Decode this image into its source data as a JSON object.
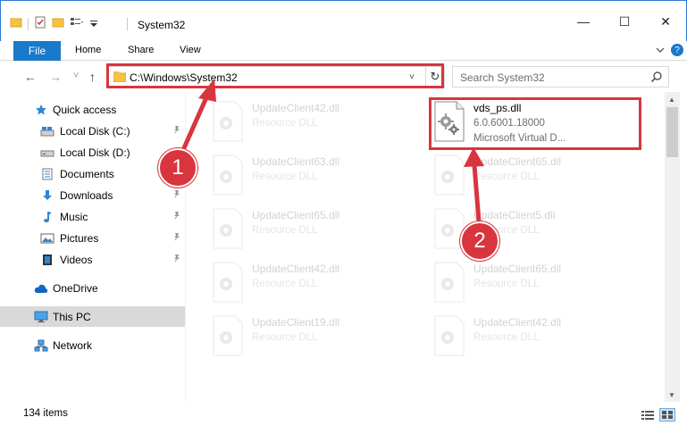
{
  "window": {
    "title": "System32",
    "minimize_glyph": "—",
    "maximize_glyph": "☐",
    "close_glyph": "✕"
  },
  "ribbon": {
    "file_tab": "File",
    "home_tab": "Home",
    "share_tab": "Share",
    "view_tab": "View",
    "help_glyph": "?"
  },
  "navigation": {
    "back_glyph": "←",
    "forward_glyph": "→",
    "recent_glyph": "˅",
    "up_glyph": "↑",
    "address": "C:\\Windows\\System32",
    "address_dropdown_glyph": "˅",
    "refresh_glyph": "↻",
    "search_placeholder": "Search System32"
  },
  "sidebar": {
    "quick_access": "Quick access",
    "items": [
      {
        "label": "Local Disk (C:)",
        "pinned": true
      },
      {
        "label": "Local Disk (D:)",
        "pinned": false
      },
      {
        "label": "Documents",
        "pinned": true
      },
      {
        "label": "Downloads",
        "pinned": true
      },
      {
        "label": "Music",
        "pinned": true
      },
      {
        "label": "Pictures",
        "pinned": true
      },
      {
        "label": "Videos",
        "pinned": true
      }
    ],
    "onedrive": "OneDrive",
    "this_pc": "This PC",
    "network": "Network",
    "pin_glyph": "📌"
  },
  "files": {
    "highlighted": {
      "name": "vds_ps.dll",
      "version": "6.0.6001.18000",
      "description": "Microsoft Virtual D..."
    },
    "faded": [
      {
        "name": "UpdateClient42.dll",
        "type": "Resource DLL"
      },
      {
        "name": "UpdateClient63.dll",
        "type": "Resource DLL"
      },
      {
        "name": "UpdateClient65.dll",
        "type": "Resource DLL"
      },
      {
        "name": "UpdateClient65.dll",
        "type": "Resource DLL"
      },
      {
        "name": "UpdateClient5.dll",
        "type": "Resource DLL"
      },
      {
        "name": "UpdateClient42.dll",
        "type": "Resource DLL"
      },
      {
        "name": "UpdateClient65.dll",
        "type": "Resource DLL"
      },
      {
        "name": "UpdateClient19.dll",
        "type": "Resource DLL"
      },
      {
        "name": "UpdateClient42.dll",
        "type": "Resource DLL"
      }
    ]
  },
  "status": {
    "item_count": "134 items"
  },
  "annotations": {
    "step1": "1",
    "step2": "2"
  },
  "colors": {
    "accent_blue": "#1979ca",
    "highlight_red": "#d8353e",
    "folder_yellow": "#f5c243"
  },
  "scrollbar": {
    "up_glyph": "▲",
    "down_glyph": "▼"
  }
}
